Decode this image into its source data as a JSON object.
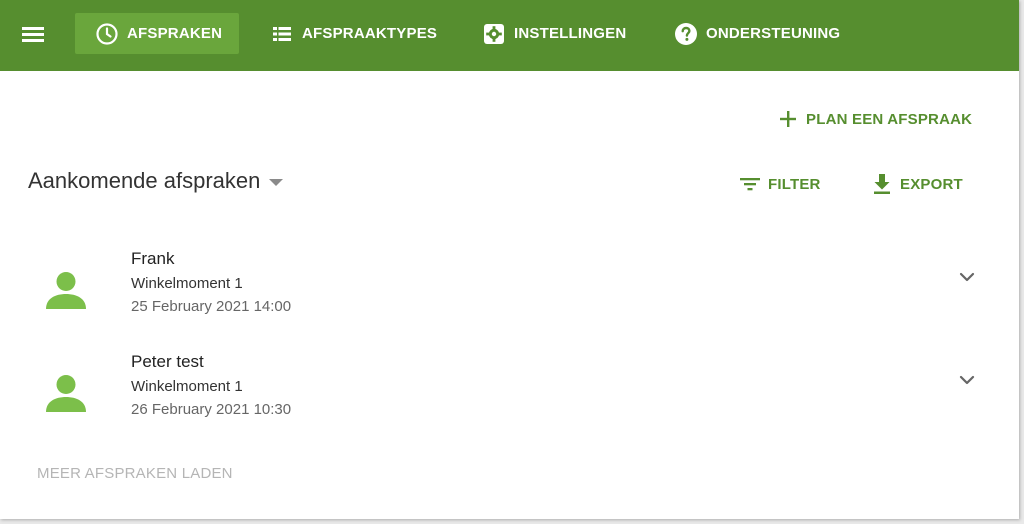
{
  "nav": {
    "menu_icon": "hamburger-icon",
    "items": [
      {
        "label": "AFSPRAKEN",
        "icon": "clock-icon",
        "active": true
      },
      {
        "label": "AFSPRAAKTYPES",
        "icon": "list-icon",
        "active": false
      },
      {
        "label": "INSTELLINGEN",
        "icon": "gear-icon",
        "active": false
      },
      {
        "label": "ONDERSTEUNING",
        "icon": "help-icon",
        "active": false
      }
    ]
  },
  "actions": {
    "plan_label": "PLAN EEN AFSPRAAK",
    "filter_label": "FILTER",
    "export_label": "EXPORT"
  },
  "section": {
    "title": "Aankomende afspraken"
  },
  "appointments": [
    {
      "name": "Frank",
      "type": "Winkelmoment 1",
      "datetime": "25 February 2021 14:00"
    },
    {
      "name": "Peter test",
      "type": "Winkelmoment 1",
      "datetime": "26 February 2021 10:30"
    }
  ],
  "load_more_label": "MEER AFSPRAKEN LADEN",
  "colors": {
    "primary": "#568e2f",
    "active_nav": "#6aa63c",
    "avatar": "#7cbf4a",
    "muted_text": "#b5b5b5"
  }
}
